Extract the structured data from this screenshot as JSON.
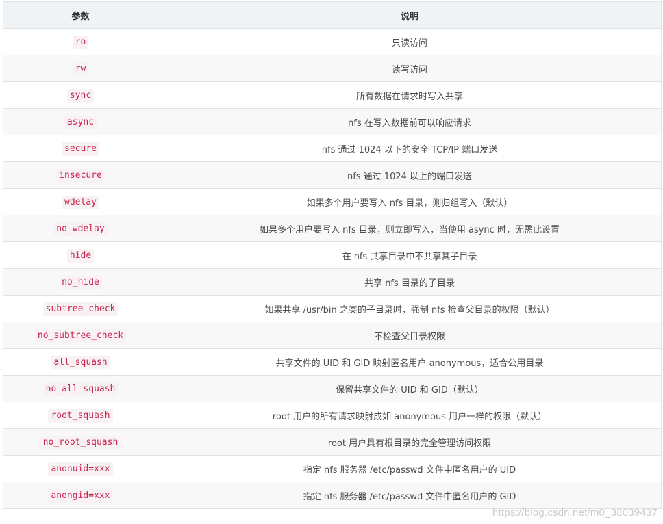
{
  "table": {
    "headers": [
      "参数",
      "说明"
    ],
    "rows": [
      {
        "param": "ro",
        "desc": "只读访问"
      },
      {
        "param": "rw",
        "desc": "读写访问"
      },
      {
        "param": "sync",
        "desc": "所有数据在请求时写入共享"
      },
      {
        "param": "async",
        "desc": "nfs 在写入数据前可以响应请求"
      },
      {
        "param": "secure",
        "desc": "nfs 通过 1024 以下的安全 TCP/IP 端口发送"
      },
      {
        "param": "insecure",
        "desc": "nfs 通过 1024 以上的端口发送"
      },
      {
        "param": "wdelay",
        "desc": "如果多个用户要写入 nfs 目录，则归组写入（默认）"
      },
      {
        "param": "no_wdelay",
        "desc": "如果多个用户要写入 nfs 目录，则立即写入，当使用 async 时，无需此设置"
      },
      {
        "param": "hide",
        "desc": "在 nfs 共享目录中不共享其子目录"
      },
      {
        "param": "no_hide",
        "desc": "共享 nfs 目录的子目录"
      },
      {
        "param": "subtree_check",
        "desc": "如果共享 /usr/bin 之类的子目录时，强制 nfs 检查父目录的权限（默认）"
      },
      {
        "param": "no_subtree_check",
        "desc": "不检查父目录权限"
      },
      {
        "param": "all_squash",
        "desc": "共享文件的 UID 和 GID 映射匿名用户 anonymous，适合公用目录"
      },
      {
        "param": "no_all_squash",
        "desc": "保留共享文件的 UID 和 GID（默认）"
      },
      {
        "param": "root_squash",
        "desc": "root 用户的所有请求映射成如 anonymous 用户一样的权限（默认）"
      },
      {
        "param": "no_root_squash",
        "desc": "root 用户具有根目录的完全管理访问权限"
      },
      {
        "param": "anonuid=xxx",
        "desc": "指定 nfs 服务器 /etc/passwd 文件中匿名用户的 UID"
      },
      {
        "param": "anongid=xxx",
        "desc": "指定 nfs 服务器 /etc/passwd 文件中匿名用户的 GID"
      }
    ]
  },
  "watermark": "https://blog.csdn.net/m0_38039437",
  "colors": {
    "code_text": "#c7254e",
    "code_bg": "#f9f2f4",
    "header_bg": "#eff3f5",
    "border": "#dfe2e5"
  }
}
